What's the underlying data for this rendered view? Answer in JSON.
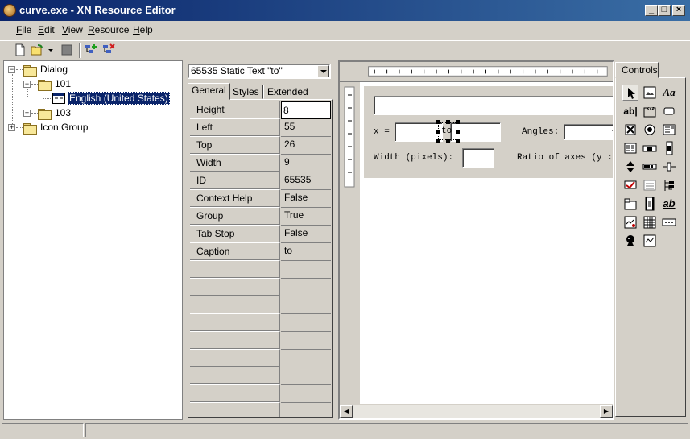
{
  "window": {
    "title": "curve.exe - XN Resource Editor"
  },
  "menu": [
    "File",
    "Edit",
    "View",
    "Resource",
    "Help"
  ],
  "tree": {
    "root": "Dialog",
    "child": "101",
    "leaf": "English (United States)",
    "sibling": "103",
    "root2": "Icon Group"
  },
  "props": {
    "combo": "65535 Static Text \"to\"",
    "tabs": [
      "General",
      "Styles",
      "Extended"
    ],
    "rows": [
      {
        "k": "Height",
        "v": "8"
      },
      {
        "k": "Left",
        "v": "55"
      },
      {
        "k": "Top",
        "v": "26"
      },
      {
        "k": "Width",
        "v": "9"
      },
      {
        "k": "ID",
        "v": "65535"
      },
      {
        "k": "Context Help",
        "v": "False"
      },
      {
        "k": "Group",
        "v": "True"
      },
      {
        "k": "Tab Stop",
        "v": "False"
      },
      {
        "k": "Caption",
        "v": "to"
      }
    ]
  },
  "designer": {
    "x_label": "x =",
    "to_label": "to",
    "angles_label": "Angles:",
    "width_label": "Width (pixels):",
    "ratio_label": "Ratio of axes (y :"
  },
  "controls": {
    "tab": "Controls"
  }
}
